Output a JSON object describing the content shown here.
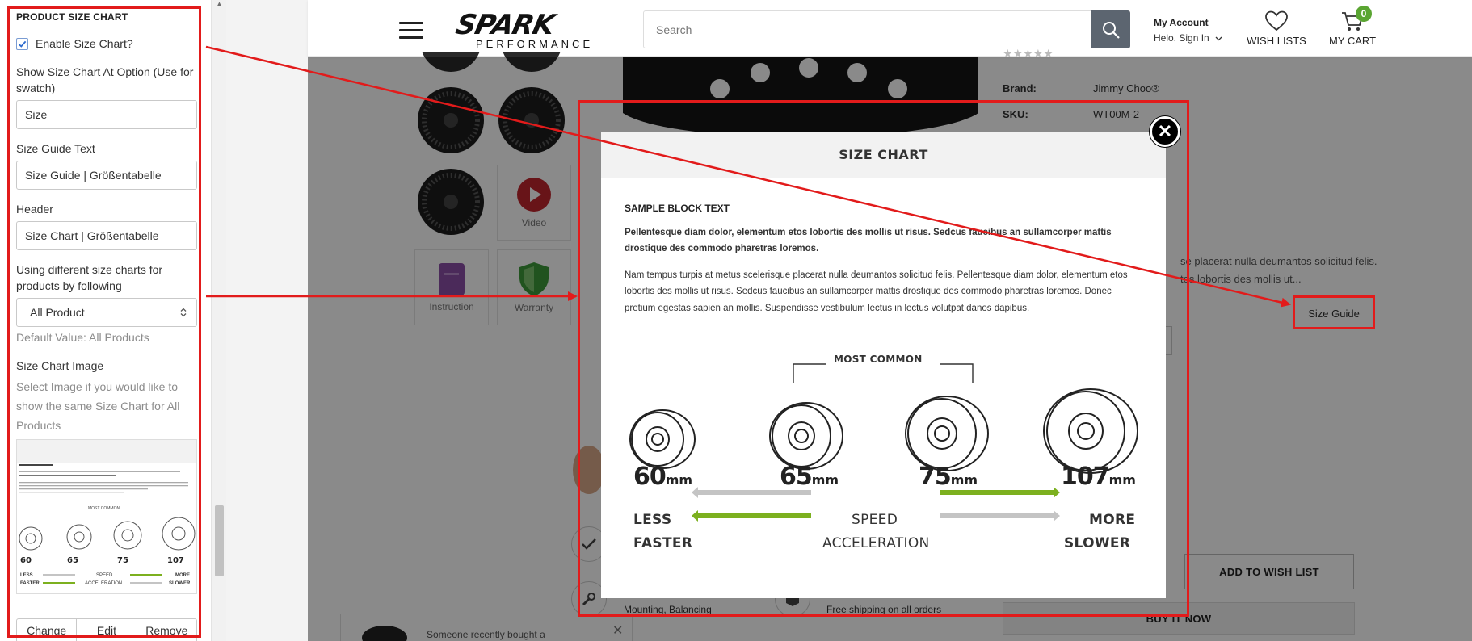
{
  "panel": {
    "title": "PRODUCT SIZE CHART",
    "enable_label": "Enable Size Chart?",
    "enable_checked": true,
    "show_at_label": "Show Size Chart At Option (Use for swatch)",
    "show_at_value": "Size",
    "guide_text_label": "Size Guide Text",
    "guide_text_value": "Size Guide | Größentabelle",
    "header_label": "Header",
    "header_value": "Size Chart | Größentabelle",
    "different_label": "Using different size charts for products by following",
    "different_value": "All Product",
    "default_hint": "Default Value: All Products",
    "image_label": "Size Chart Image",
    "image_hint": "Select Image if you would like to show the same Size Chart for All Products",
    "btn_change": "Change",
    "btn_edit": "Edit",
    "btn_remove": "Remove"
  },
  "header": {
    "logo_main": "SPARK",
    "logo_sub": "PERFORMANCE",
    "search_placeholder": "Search",
    "account_title": "My Account",
    "account_sub": "Helo. Sign In",
    "wishlist_label": "WISH LISTS",
    "cart_label": "MY CART",
    "cart_count": "0"
  },
  "product": {
    "brand_label": "Brand:",
    "brand_value": "Jimmy Choo®",
    "sku_label": "SKU:",
    "sku_value": "WT00M-2",
    "desc_line1": "se placerat nulla deumantos solicitud felis.",
    "desc_line2": "tos lobortis des mollis ut...",
    "size_guide": "Size Guide",
    "add_wishlist": "ADD TO WISH LIST",
    "buy_now": "BUY IT NOW",
    "gallery_video": "Video",
    "gallery_instruction": "Instruction",
    "gallery_warranty": "Warranty",
    "service_mounting": "Mounting, Balancing",
    "service_shipping": "Free shipping on all orders",
    "recent_bought": "Someone recently bought a"
  },
  "modal": {
    "title": "SIZE CHART",
    "block_title": "SAMPLE BLOCK TEXT",
    "bold_para": "Pellentesque diam dolor, elementum etos lobortis des mollis ut risus. Sedcus faucibus an sullamcorper mattis drostique des commodo pharetras loremos.",
    "para": "Nam tempus turpis at metus scelerisque placerat nulla deumantos solicitud felis. Pellentesque diam dolor, elementum etos lobortis des mollis ut risus. Sedcus faucibus an sullamcorper mattis drostique des commodo pharetras loremos. Donec pretium egestas sapien an mollis. Suspendisse vestibulum lectus in lectus volutpat danos dapibus.",
    "most_common": "MOST COMMON",
    "sizes": [
      {
        "num": "60",
        "unit": "mm"
      },
      {
        "num": "65",
        "unit": "mm"
      },
      {
        "num": "75",
        "unit": "mm"
      },
      {
        "num": "107",
        "unit": "mm"
      }
    ],
    "less": "LESS",
    "faster": "FASTER",
    "speed": "SPEED",
    "acceleration": "ACCELERATION",
    "more": "MORE",
    "slower": "SLOWER",
    "close_icon": "close-icon"
  },
  "colors": {
    "annotation_red": "#e21b1b",
    "arrow_green": "#7cb01f",
    "arrow_gray": "#c4c4c4",
    "cart_badge": "#5aa532",
    "video_red": "#c0262d",
    "instruction_purple": "#8b4fa6",
    "warranty_green": "#3e9a3a"
  }
}
